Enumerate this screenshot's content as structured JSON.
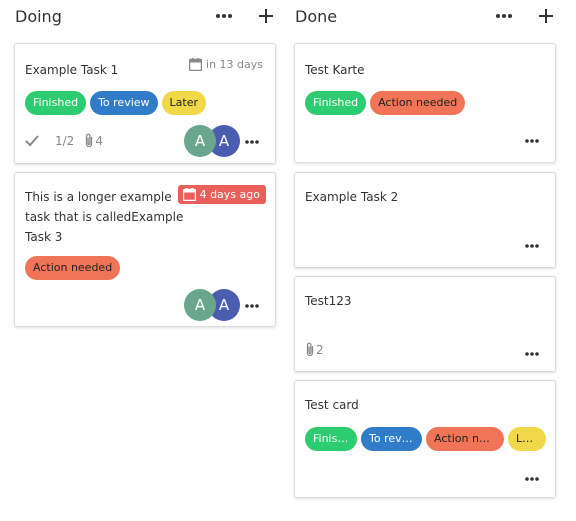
{
  "columns": [
    {
      "title": "Doing",
      "cards": [
        {
          "title": "Example Task 1",
          "due": "in 13 days",
          "labels": [
            "Finished",
            "To review",
            "Later"
          ],
          "checklist": "1/2",
          "attachments": "4",
          "avatars": [
            "A",
            "A"
          ]
        },
        {
          "title_lines": [
            "This is a longer example",
            "task that is calledExample",
            "Task 3"
          ],
          "due": "4 days ago",
          "labels": [
            "Action needed"
          ],
          "avatars": [
            "A",
            "A"
          ]
        }
      ]
    },
    {
      "title": "Done",
      "cards": [
        {
          "title": "Test Karte",
          "labels": [
            "Finished",
            "Action needed"
          ]
        },
        {
          "title": "Example Task 2"
        },
        {
          "title": "Test123",
          "attachments": "2"
        },
        {
          "title": "Test card",
          "labels": [
            "Finish…",
            "To revi…",
            "Action need…",
            "La…"
          ]
        }
      ]
    }
  ],
  "colors": {
    "finished": "#2ecc71",
    "to_review": "#317cc9",
    "later": "#f0d84a",
    "action_needed": "#f07458",
    "overdue": "#e9605a",
    "avatar_1": "#6aa58d",
    "avatar_2": "#4a5db0"
  },
  "icons": [
    "more-icon",
    "plus-icon",
    "calendar-icon",
    "check-icon",
    "paperclip-icon"
  ]
}
